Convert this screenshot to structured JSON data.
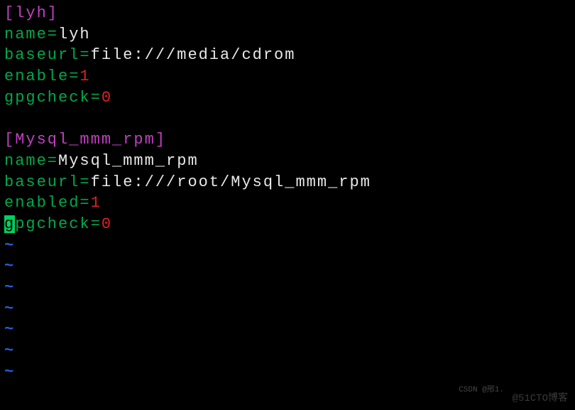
{
  "sections": [
    {
      "header": "[lyh]",
      "entries": [
        {
          "key": "name=",
          "value": "lyh",
          "valueColor": "white"
        },
        {
          "key": "baseurl=",
          "value": "file:///media/cdrom",
          "valueColor": "white"
        },
        {
          "key": "enable=",
          "value": "1",
          "valueColor": "red"
        },
        {
          "key": "gpgcheck=",
          "value": "0",
          "valueColor": "red"
        }
      ]
    },
    {
      "header": "[Mysql_mmm_rpm]",
      "entries": [
        {
          "key": "name=",
          "value": "Mysql_mmm_rpm",
          "valueColor": "white"
        },
        {
          "key": "baseurl=",
          "value": "file:///root/Mysql_mmm_rpm",
          "valueColor": "white"
        },
        {
          "key": "enabled=",
          "value": "1",
          "valueColor": "red"
        },
        {
          "key_cursor": "g",
          "key_rest": "pgcheck=",
          "value": "0",
          "valueColor": "red"
        }
      ]
    }
  ],
  "tilde": "~",
  "blank": "",
  "watermark1": "CSDN @邢1.",
  "watermark2": "@51CTO博客"
}
